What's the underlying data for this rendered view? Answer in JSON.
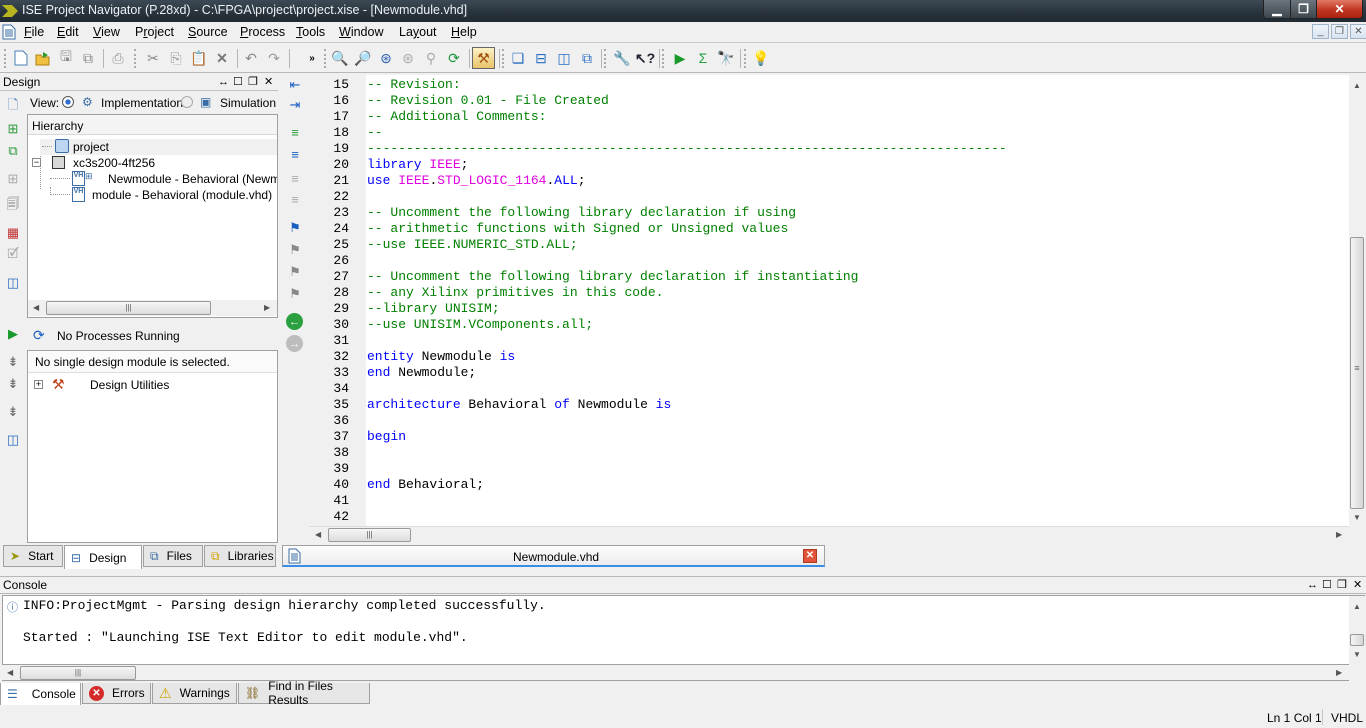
{
  "window": {
    "title": "ISE Project Navigator (P.28xd) - C:\\FPGA\\project\\project.xise - [Newmodule.vhd]",
    "controls": [
      "minimize",
      "restore",
      "close"
    ]
  },
  "menubar": {
    "items": [
      {
        "label": "File",
        "mnemonic": "F"
      },
      {
        "label": "Edit",
        "mnemonic": "E"
      },
      {
        "label": "View",
        "mnemonic": "V"
      },
      {
        "label": "Project",
        "mnemonic": "r"
      },
      {
        "label": "Source",
        "mnemonic": "S"
      },
      {
        "label": "Process",
        "mnemonic": "P"
      },
      {
        "label": "Tools",
        "mnemonic": "T"
      },
      {
        "label": "Window",
        "mnemonic": "W"
      },
      {
        "label": "Layout",
        "mnemonic": "y"
      },
      {
        "label": "Help",
        "mnemonic": "H"
      }
    ]
  },
  "toolbar": {
    "buttons": [
      {
        "name": "new",
        "icon": "new-file-icon"
      },
      {
        "name": "open",
        "icon": "open-folder-icon"
      },
      {
        "name": "save",
        "icon": "save-icon"
      },
      {
        "name": "save-all",
        "icon": "save-all-icon"
      },
      {
        "name": "print",
        "icon": "print-icon"
      },
      {
        "name": "cut",
        "icon": "cut-icon"
      },
      {
        "name": "copy",
        "icon": "copy-icon"
      },
      {
        "name": "paste",
        "icon": "paste-icon"
      },
      {
        "name": "delete",
        "icon": "delete-icon"
      },
      {
        "name": "undo",
        "icon": "undo-icon"
      },
      {
        "name": "redo",
        "icon": "redo-icon"
      },
      {
        "name": "overflow",
        "icon": "overflow-chevron-icon"
      },
      {
        "name": "zoom-in",
        "icon": "zoom-in-icon"
      },
      {
        "name": "zoom-out",
        "icon": "zoom-out-icon"
      },
      {
        "name": "zoom-fit",
        "icon": "zoom-fit-icon"
      },
      {
        "name": "zoom-selection",
        "icon": "zoom-selection-icon"
      },
      {
        "name": "find",
        "icon": "find-icon"
      },
      {
        "name": "refresh",
        "icon": "refresh-icon"
      },
      {
        "name": "implement-top",
        "icon": "hammer-icon"
      },
      {
        "name": "cascade",
        "icon": "cascade-windows-icon"
      },
      {
        "name": "tile-horizontal",
        "icon": "tile-horizontal-icon"
      },
      {
        "name": "tile-vertical",
        "icon": "tile-vertical-icon"
      },
      {
        "name": "windows",
        "icon": "windows-icon"
      },
      {
        "name": "properties",
        "icon": "wrench-icon"
      },
      {
        "name": "help-context",
        "icon": "whats-this-icon"
      },
      {
        "name": "run",
        "icon": "run-icon"
      },
      {
        "name": "summary",
        "icon": "sigma-icon"
      },
      {
        "name": "explore",
        "icon": "telescope-icon"
      },
      {
        "name": "tips",
        "icon": "lightbulb-icon"
      }
    ]
  },
  "design_panel": {
    "title": "Design",
    "view_label": "View:",
    "view_options": [
      {
        "label": "Implementation",
        "selected": true
      },
      {
        "label": "Simulation",
        "selected": false
      }
    ],
    "hierarchy_header": "Hierarchy",
    "tree": [
      {
        "label": "project",
        "level": 0,
        "icon": "project-icon",
        "selected": true
      },
      {
        "label": "xc3s200-4ft256",
        "level": 0,
        "icon": "chip-icon",
        "expanded": true
      },
      {
        "label": "Newmodule - Behavioral (Newmodule.vhd)",
        "level": 1,
        "icon": "vhdl-top-module-icon"
      },
      {
        "label": "module - Behavioral (module.vhd)",
        "level": 1,
        "icon": "vhdl-file-icon"
      }
    ]
  },
  "process_panel": {
    "status": "No Processes Running",
    "message": "No single design module is selected.",
    "tree": [
      {
        "label": "Design Utilities",
        "icon": "design-utilities-icon",
        "expanded": false
      }
    ]
  },
  "left_tabs": [
    {
      "label": "Start",
      "icon": "start-icon",
      "active": false
    },
    {
      "label": "Design",
      "icon": "design-icon",
      "active": true
    },
    {
      "label": "Files",
      "icon": "files-icon",
      "active": false
    },
    {
      "label": "Libraries",
      "icon": "libraries-icon",
      "active": false
    }
  ],
  "editor": {
    "file_tab": "Newmodule.vhd",
    "lines": [
      {
        "n": "15",
        "tokens": [
          {
            "t": "-- Revision:",
            "c": "comment"
          }
        ]
      },
      {
        "n": "16",
        "tokens": [
          {
            "t": "-- Revision 0.01 - File Created",
            "c": "comment"
          }
        ]
      },
      {
        "n": "17",
        "tokens": [
          {
            "t": "-- Additional Comments:",
            "c": "comment"
          }
        ]
      },
      {
        "n": "18",
        "tokens": [
          {
            "t": "--",
            "c": "comment"
          }
        ]
      },
      {
        "n": "19",
        "tokens": [
          {
            "t": "----------------------------------------------------------------------------------",
            "c": "comment"
          }
        ]
      },
      {
        "n": "20",
        "tokens": [
          {
            "t": "library ",
            "c": "kw"
          },
          {
            "t": "IEEE",
            "c": "lib"
          },
          {
            "t": ";",
            "c": "plain"
          }
        ]
      },
      {
        "n": "21",
        "tokens": [
          {
            "t": "use ",
            "c": "kw"
          },
          {
            "t": "IEEE",
            "c": "lib"
          },
          {
            "t": ".",
            "c": "plain"
          },
          {
            "t": "STD_LOGIC_1164",
            "c": "lib"
          },
          {
            "t": ".",
            "c": "plain"
          },
          {
            "t": "ALL",
            "c": "kw"
          },
          {
            "t": ";",
            "c": "plain"
          }
        ]
      },
      {
        "n": "22",
        "tokens": []
      },
      {
        "n": "23",
        "tokens": [
          {
            "t": "-- Uncomment the following library declaration if using",
            "c": "comment"
          }
        ]
      },
      {
        "n": "24",
        "tokens": [
          {
            "t": "-- arithmetic functions with Signed or Unsigned values",
            "c": "comment"
          }
        ]
      },
      {
        "n": "25",
        "tokens": [
          {
            "t": "--use IEEE.NUMERIC_STD.ALL;",
            "c": "comment"
          }
        ]
      },
      {
        "n": "26",
        "tokens": []
      },
      {
        "n": "27",
        "tokens": [
          {
            "t": "-- Uncomment the following library declaration if instantiating",
            "c": "comment"
          }
        ]
      },
      {
        "n": "28",
        "tokens": [
          {
            "t": "-- any Xilinx primitives in this code.",
            "c": "comment"
          }
        ]
      },
      {
        "n": "29",
        "tokens": [
          {
            "t": "--library UNISIM;",
            "c": "comment"
          }
        ]
      },
      {
        "n": "30",
        "tokens": [
          {
            "t": "--use UNISIM.VComponents.all;",
            "c": "comment"
          }
        ]
      },
      {
        "n": "31",
        "tokens": []
      },
      {
        "n": "32",
        "tokens": [
          {
            "t": "entity ",
            "c": "kw"
          },
          {
            "t": "Newmodule ",
            "c": "plain"
          },
          {
            "t": "is",
            "c": "kw"
          }
        ]
      },
      {
        "n": "33",
        "tokens": [
          {
            "t": "end ",
            "c": "kw"
          },
          {
            "t": "Newmodule;",
            "c": "plain"
          }
        ]
      },
      {
        "n": "34",
        "tokens": []
      },
      {
        "n": "35",
        "tokens": [
          {
            "t": "architecture ",
            "c": "kw"
          },
          {
            "t": "Behavioral ",
            "c": "plain"
          },
          {
            "t": "of ",
            "c": "kw"
          },
          {
            "t": "Newmodule ",
            "c": "plain"
          },
          {
            "t": "is",
            "c": "kw"
          }
        ]
      },
      {
        "n": "36",
        "tokens": []
      },
      {
        "n": "37",
        "tokens": [
          {
            "t": "begin",
            "c": "kw"
          }
        ]
      },
      {
        "n": "38",
        "tokens": []
      },
      {
        "n": "39",
        "tokens": []
      },
      {
        "n": "40",
        "tokens": [
          {
            "t": "end ",
            "c": "kw"
          },
          {
            "t": "Behavioral;",
            "c": "plain"
          }
        ]
      },
      {
        "n": "41",
        "tokens": []
      },
      {
        "n": "42",
        "tokens": []
      }
    ],
    "colors": {
      "comment": "#008000",
      "kw": "#0000ff",
      "lib": "#e000e0",
      "plain": "#000000"
    }
  },
  "console": {
    "title": "Console",
    "lines": [
      "INFO:ProjectMgmt - Parsing design hierarchy completed successfully.",
      "",
      "Started : \"Launching ISE Text Editor to edit module.vhd\"."
    ],
    "tabs": [
      {
        "label": "Console",
        "icon": "console-icon",
        "active": true
      },
      {
        "label": "Errors",
        "icon": "error-icon",
        "active": false
      },
      {
        "label": "Warnings",
        "icon": "warning-icon",
        "active": false
      },
      {
        "label": "Find in Files Results",
        "icon": "binoculars-icon",
        "active": false
      }
    ]
  },
  "statusbar": {
    "position": "Ln 1 Col 1",
    "language": "VHDL"
  }
}
